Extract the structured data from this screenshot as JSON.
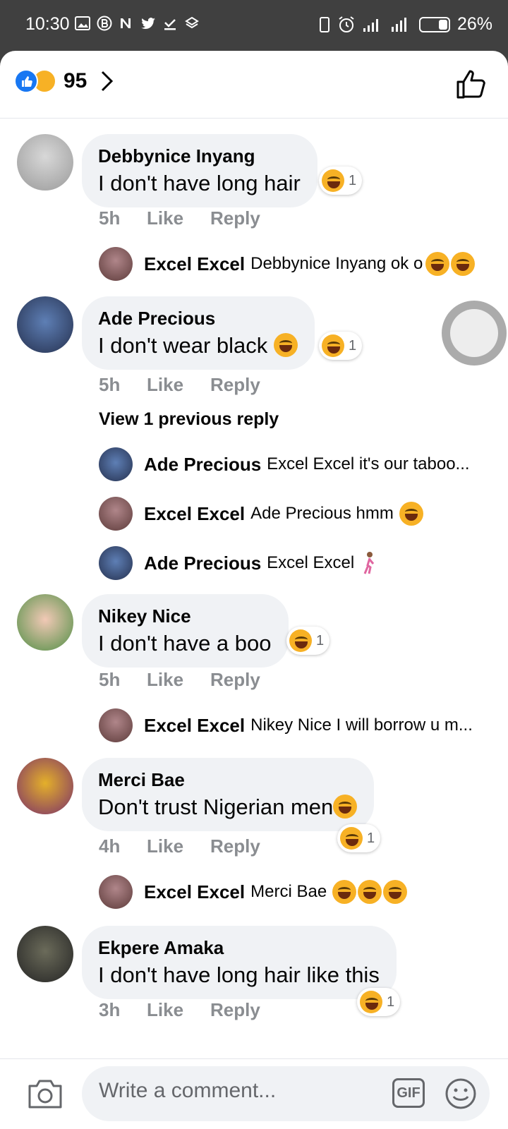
{
  "status_bar": {
    "time": "10:30",
    "battery": "26%"
  },
  "header": {
    "reaction_count": "95"
  },
  "actions": {
    "like": "Like",
    "reply": "Reply"
  },
  "comments": [
    {
      "author": "Debbynice Inyang",
      "text": "I don't have long hair",
      "time": "5h",
      "reaction_count": "1",
      "replies": [
        {
          "author": "Excel Excel",
          "text": "Debbynice Inyang ok o"
        }
      ]
    },
    {
      "author": "Ade Precious",
      "text": "I don't wear black",
      "time": "5h",
      "reaction_count": "1",
      "view_previous": "View 1 previous reply",
      "replies": [
        {
          "author": "Ade Precious",
          "text": "Excel Excel it's our taboo..."
        },
        {
          "author": "Excel Excel",
          "text": "Ade Precious hmm"
        },
        {
          "author": "Ade Precious",
          "text": "Excel Excel"
        }
      ]
    },
    {
      "author": "Nikey Nice",
      "text": "I don't have a boo",
      "time": "5h",
      "reaction_count": "1",
      "replies": [
        {
          "author": "Excel Excel",
          "text": "Nikey Nice I will borrow u m..."
        }
      ]
    },
    {
      "author": "Merci Bae",
      "text": "Don't trust Nigerian men",
      "time": "4h",
      "reaction_count": "1",
      "replies": [
        {
          "author": "Excel Excel",
          "text": "Merci Bae"
        }
      ]
    },
    {
      "author": "Ekpere Amaka",
      "text": "I don't have long hair like this",
      "time": "3h",
      "reaction_count": "1"
    }
  ],
  "composer": {
    "placeholder": "Write a comment...",
    "gif_label": "GIF"
  },
  "colors": {
    "accent": "#1877f2",
    "laugh": "#f7b125",
    "bubble": "#f0f2f5",
    "meta": "#8a8d91"
  }
}
